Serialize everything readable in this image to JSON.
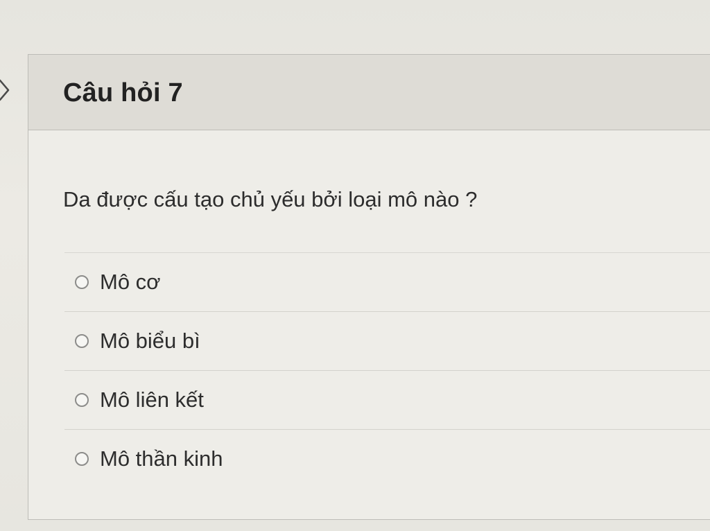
{
  "question": {
    "title": "Câu hỏi 7",
    "text": "Da được cấu tạo chủ yếu bởi loại mô nào ?",
    "options": [
      {
        "label": "Mô cơ",
        "selected": false
      },
      {
        "label": "Mô biểu bì",
        "selected": false
      },
      {
        "label": "Mô liên kết",
        "selected": false
      },
      {
        "label": "Mô thần kinh",
        "selected": false
      }
    ]
  },
  "icons": {
    "left_nav": "chevron-right-icon"
  }
}
